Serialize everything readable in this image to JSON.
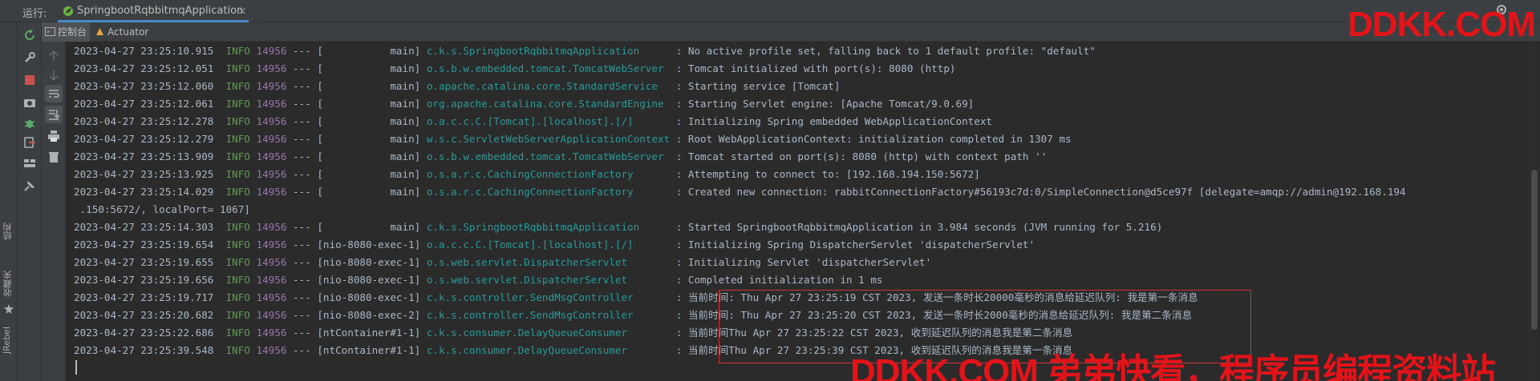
{
  "runbar": {
    "label": "运行:",
    "tab_title": "SpringbootRqbbitmqApplication",
    "close_glyph": "×"
  },
  "subtabs": {
    "console": "控制台",
    "actuator": "Actuator"
  },
  "side_tabs": {
    "structure": "结构",
    "favorites": "收藏夹",
    "jrebel": "JRebel"
  },
  "colors": {
    "timestamp": "#a9b7c6",
    "level": "#629755",
    "pid": "#9876aa",
    "logger": "#299999",
    "highlight": "#cc3333",
    "watermark": "#e2141a"
  },
  "console": {
    "lines": [
      {
        "ts": "2023-04-27 23:25:10.915",
        "level": "INFO",
        "pid": "14956",
        "sep": " --- [",
        "thread": "           main]",
        "logger": "c.k.s.SpringbootRqbbitmqApplication     ",
        "msg": " : No active profile set, falling back to 1 default profile: \"default\""
      },
      {
        "ts": "2023-04-27 23:25:12.051",
        "level": "INFO",
        "pid": "14956",
        "sep": " --- [",
        "thread": "           main]",
        "logger": "o.s.b.w.embedded.tomcat.TomcatWebServer ",
        "msg": " : Tomcat initialized with port(s): 8080 (http)"
      },
      {
        "ts": "2023-04-27 23:25:12.060",
        "level": "INFO",
        "pid": "14956",
        "sep": " --- [",
        "thread": "           main]",
        "logger": "o.apache.catalina.core.StandardService  ",
        "msg": " : Starting service [Tomcat]"
      },
      {
        "ts": "2023-04-27 23:25:12.061",
        "level": "INFO",
        "pid": "14956",
        "sep": " --- [",
        "thread": "           main]",
        "logger": "org.apache.catalina.core.StandardEngine ",
        "msg": " : Starting Servlet engine: [Apache Tomcat/9.0.69]"
      },
      {
        "ts": "2023-04-27 23:25:12.278",
        "level": "INFO",
        "pid": "14956",
        "sep": " --- [",
        "thread": "           main]",
        "logger": "o.a.c.c.C.[Tomcat].[localhost].[/]      ",
        "msg": " : Initializing Spring embedded WebApplicationContext"
      },
      {
        "ts": "2023-04-27 23:25:12.279",
        "level": "INFO",
        "pid": "14956",
        "sep": " --- [",
        "thread": "           main]",
        "logger": "w.s.c.ServletWebServerApplicationContext",
        "msg": " : Root WebApplicationContext: initialization completed in 1307 ms"
      },
      {
        "ts": "2023-04-27 23:25:13.909",
        "level": "INFO",
        "pid": "14956",
        "sep": " --- [",
        "thread": "           main]",
        "logger": "o.s.b.w.embedded.tomcat.TomcatWebServer ",
        "msg": " : Tomcat started on port(s): 8080 (http) with context path ''"
      },
      {
        "ts": "2023-04-27 23:25:13.925",
        "level": "INFO",
        "pid": "14956",
        "sep": " --- [",
        "thread": "           main]",
        "logger": "o.s.a.r.c.CachingConnectionFactory      ",
        "msg": " : Attempting to connect to: [192.168.194.150:5672]"
      },
      {
        "ts": "2023-04-27 23:25:14.029",
        "level": "INFO",
        "pid": "14956",
        "sep": " --- [",
        "thread": "           main]",
        "logger": "o.s.a.r.c.CachingConnectionFactory      ",
        "msg": " : Created new connection: rabbitConnectionFactory#56193c7d:0/SimpleConnection@d5ce97f [delegate=amqp://admin@192.168.194"
      },
      {
        "ts": "",
        "level": "",
        "pid": "",
        "sep": "",
        "thread": "",
        "logger": "",
        "msg": " .150:5672/, localPort= 1067]"
      },
      {
        "ts": "2023-04-27 23:25:14.303",
        "level": "INFO",
        "pid": "14956",
        "sep": " --- [",
        "thread": "           main]",
        "logger": "c.k.s.SpringbootRqbbitmqApplication     ",
        "msg": " : Started SpringbootRqbbitmqApplication in 3.984 seconds (JVM running for 5.216)"
      },
      {
        "ts": "2023-04-27 23:25:19.654",
        "level": "INFO",
        "pid": "14956",
        "sep": " --- [",
        "thread": "nio-8080-exec-1]",
        "logger": "o.a.c.c.C.[Tomcat].[localhost].[/]      ",
        "msg": " : Initializing Spring DispatcherServlet 'dispatcherServlet'"
      },
      {
        "ts": "2023-04-27 23:25:19.655",
        "level": "INFO",
        "pid": "14956",
        "sep": " --- [",
        "thread": "nio-8080-exec-1]",
        "logger": "o.s.web.servlet.DispatcherServlet       ",
        "msg": " : Initializing Servlet 'dispatcherServlet'"
      },
      {
        "ts": "2023-04-27 23:25:19.656",
        "level": "INFO",
        "pid": "14956",
        "sep": " --- [",
        "thread": "nio-8080-exec-1]",
        "logger": "o.s.web.servlet.DispatcherServlet       ",
        "msg": " : Completed initialization in 1 ms"
      },
      {
        "ts": "2023-04-27 23:25:19.717",
        "level": "INFO",
        "pid": "14956",
        "sep": " --- [",
        "thread": "nio-8080-exec-1]",
        "logger": "c.k.s.controller.SendMsgController      ",
        "msg": " : 当前时间: Thu Apr 27 23:25:19 CST 2023, 发送一条时长20000毫秒的消息给延迟队列: 我是第一条消息"
      },
      {
        "ts": "2023-04-27 23:25:20.682",
        "level": "INFO",
        "pid": "14956",
        "sep": " --- [",
        "thread": "nio-8080-exec-2]",
        "logger": "c.k.s.controller.SendMsgController      ",
        "msg": " : 当前时间: Thu Apr 27 23:25:20 CST 2023, 发送一条时长2000毫秒的消息给延迟队列: 我是第二条消息"
      },
      {
        "ts": "2023-04-27 23:25:22.686",
        "level": "INFO",
        "pid": "14956",
        "sep": " --- [",
        "thread": "ntContainer#1-1]",
        "logger": "c.k.s.consumer.DelayQueueConsumer       ",
        "msg": " : 当前时间Thu Apr 27 23:25:22 CST 2023, 收到延迟队列的消息我是第二条消息"
      },
      {
        "ts": "2023-04-27 23:25:39.548",
        "level": "INFO",
        "pid": "14956",
        "sep": " --- [",
        "thread": "ntContainer#1-1]",
        "logger": "c.k.s.consumer.DelayQueueConsumer       ",
        "msg": " : 当前时间Thu Apr 27 23:25:39 CST 2023, 收到延迟队列的消息我是第一条消息"
      }
    ]
  },
  "watermarks": {
    "top": "DDKK.COM",
    "bottom": "DDKK.COM 弟弟快看，程序员编程资料站"
  }
}
